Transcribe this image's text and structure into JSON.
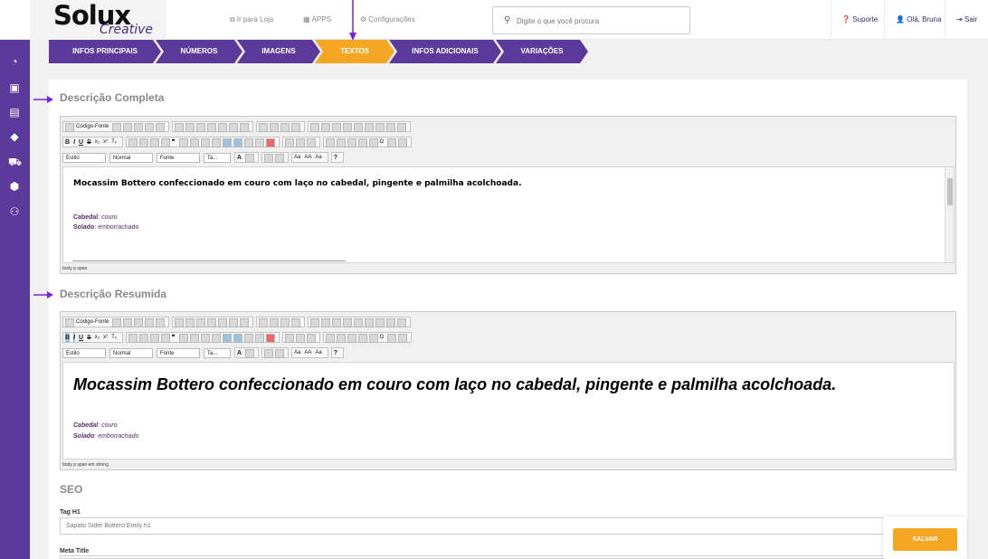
{
  "header": {
    "logo_main": "Solux",
    "logo_sub": "Creative",
    "links": [
      {
        "label": "Ir para Loja",
        "icon": "external-link-icon"
      },
      {
        "label": "APPS",
        "icon": "grid-icon"
      },
      {
        "label": "Configurações",
        "icon": "gear-icon"
      }
    ],
    "search_placeholder": "Digite o que você procura",
    "support_label": "Suporte",
    "user_label": "Olá, Bruna",
    "logout_label": "Sair"
  },
  "sidebar": {
    "items": [
      {
        "icon": "dashboard-icon"
      },
      {
        "icon": "bag-icon"
      },
      {
        "icon": "document-icon"
      },
      {
        "icon": "tag-icon"
      },
      {
        "icon": "cart-icon"
      },
      {
        "icon": "box-icon"
      },
      {
        "icon": "users-icon"
      }
    ]
  },
  "steps": [
    {
      "label": "INFOS PRINCIPAIS",
      "active": false
    },
    {
      "label": "NÚMEROS",
      "active": false
    },
    {
      "label": "IMAGENS",
      "active": false
    },
    {
      "label": "TEXTOS",
      "active": true
    },
    {
      "label": "INFOS ADICIONAIS",
      "active": false
    },
    {
      "label": "VARIAÇÕES",
      "active": false
    }
  ],
  "editor_full": {
    "title": "Descrição Completa",
    "toolbar": {
      "source_label": "Código-Fonte",
      "style_label": "Estilo",
      "format_label": "Normal",
      "font_label": "Fonte",
      "size_label": "Ta..."
    },
    "lead_text": "Mocassim Bottero confeccionado em couro com laço no cabedal, pingente e palmilha acolchoada.",
    "attr1_key": "Cabedal",
    "attr1_value": ": couro",
    "attr2_key": "Solado",
    "attr2_value": ": emborrachado",
    "status_path": "body   p   span"
  },
  "editor_short": {
    "title": "Descrição Resumida",
    "toolbar": {
      "source_label": "Código-Fonte",
      "style_label": "Estilo",
      "format_label": "Normal",
      "font_label": "Fonte",
      "size_label": "Ta..."
    },
    "lead_text": "Mocassim Bottero confeccionado em couro com laço no cabedal, pingente e palmilha acolchoada.",
    "attr1_key": "Cabedal",
    "attr1_value": ": couro",
    "attr2_key": "Solado",
    "attr2_value": ": emborrachado",
    "status_path": "body   p   span   em   strong"
  },
  "seo": {
    "title": "SEO",
    "h1_label": "Tag H1",
    "h1_value": "Sapato Sider Bottero Emily h1",
    "meta_title_label": "Meta Title"
  },
  "save_label": "SALVAR",
  "colors": {
    "primary": "#5b3a9c",
    "accent": "#f5a623",
    "annotation_arrow": "#7b1fe0"
  }
}
